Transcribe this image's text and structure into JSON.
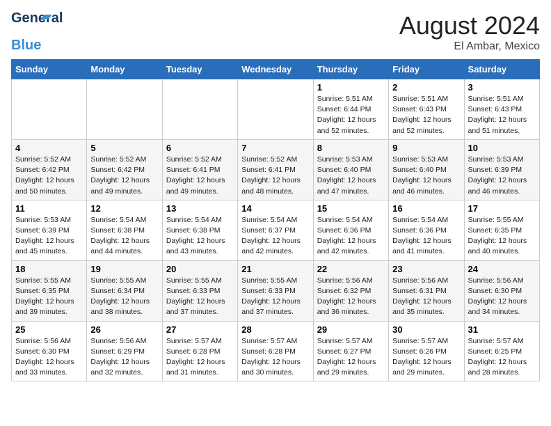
{
  "logo": {
    "line1": "General",
    "line2": "Blue"
  },
  "title": {
    "month": "August 2024",
    "location": "El Ambar, Mexico"
  },
  "header": {
    "days": [
      "Sunday",
      "Monday",
      "Tuesday",
      "Wednesday",
      "Thursday",
      "Friday",
      "Saturday"
    ]
  },
  "weeks": [
    [
      {
        "num": "",
        "info": ""
      },
      {
        "num": "",
        "info": ""
      },
      {
        "num": "",
        "info": ""
      },
      {
        "num": "",
        "info": ""
      },
      {
        "num": "1",
        "info": "Sunrise: 5:51 AM\nSunset: 6:44 PM\nDaylight: 12 hours\nand 52 minutes."
      },
      {
        "num": "2",
        "info": "Sunrise: 5:51 AM\nSunset: 6:43 PM\nDaylight: 12 hours\nand 52 minutes."
      },
      {
        "num": "3",
        "info": "Sunrise: 5:51 AM\nSunset: 6:43 PM\nDaylight: 12 hours\nand 51 minutes."
      }
    ],
    [
      {
        "num": "4",
        "info": "Sunrise: 5:52 AM\nSunset: 6:42 PM\nDaylight: 12 hours\nand 50 minutes."
      },
      {
        "num": "5",
        "info": "Sunrise: 5:52 AM\nSunset: 6:42 PM\nDaylight: 12 hours\nand 49 minutes."
      },
      {
        "num": "6",
        "info": "Sunrise: 5:52 AM\nSunset: 6:41 PM\nDaylight: 12 hours\nand 49 minutes."
      },
      {
        "num": "7",
        "info": "Sunrise: 5:52 AM\nSunset: 6:41 PM\nDaylight: 12 hours\nand 48 minutes."
      },
      {
        "num": "8",
        "info": "Sunrise: 5:53 AM\nSunset: 6:40 PM\nDaylight: 12 hours\nand 47 minutes."
      },
      {
        "num": "9",
        "info": "Sunrise: 5:53 AM\nSunset: 6:40 PM\nDaylight: 12 hours\nand 46 minutes."
      },
      {
        "num": "10",
        "info": "Sunrise: 5:53 AM\nSunset: 6:39 PM\nDaylight: 12 hours\nand 46 minutes."
      }
    ],
    [
      {
        "num": "11",
        "info": "Sunrise: 5:53 AM\nSunset: 6:39 PM\nDaylight: 12 hours\nand 45 minutes."
      },
      {
        "num": "12",
        "info": "Sunrise: 5:54 AM\nSunset: 6:38 PM\nDaylight: 12 hours\nand 44 minutes."
      },
      {
        "num": "13",
        "info": "Sunrise: 5:54 AM\nSunset: 6:38 PM\nDaylight: 12 hours\nand 43 minutes."
      },
      {
        "num": "14",
        "info": "Sunrise: 5:54 AM\nSunset: 6:37 PM\nDaylight: 12 hours\nand 42 minutes."
      },
      {
        "num": "15",
        "info": "Sunrise: 5:54 AM\nSunset: 6:36 PM\nDaylight: 12 hours\nand 42 minutes."
      },
      {
        "num": "16",
        "info": "Sunrise: 5:54 AM\nSunset: 6:36 PM\nDaylight: 12 hours\nand 41 minutes."
      },
      {
        "num": "17",
        "info": "Sunrise: 5:55 AM\nSunset: 6:35 PM\nDaylight: 12 hours\nand 40 minutes."
      }
    ],
    [
      {
        "num": "18",
        "info": "Sunrise: 5:55 AM\nSunset: 6:35 PM\nDaylight: 12 hours\nand 39 minutes."
      },
      {
        "num": "19",
        "info": "Sunrise: 5:55 AM\nSunset: 6:34 PM\nDaylight: 12 hours\nand 38 minutes."
      },
      {
        "num": "20",
        "info": "Sunrise: 5:55 AM\nSunset: 6:33 PM\nDaylight: 12 hours\nand 37 minutes."
      },
      {
        "num": "21",
        "info": "Sunrise: 5:55 AM\nSunset: 6:33 PM\nDaylight: 12 hours\nand 37 minutes."
      },
      {
        "num": "22",
        "info": "Sunrise: 5:56 AM\nSunset: 6:32 PM\nDaylight: 12 hours\nand 36 minutes."
      },
      {
        "num": "23",
        "info": "Sunrise: 5:56 AM\nSunset: 6:31 PM\nDaylight: 12 hours\nand 35 minutes."
      },
      {
        "num": "24",
        "info": "Sunrise: 5:56 AM\nSunset: 6:30 PM\nDaylight: 12 hours\nand 34 minutes."
      }
    ],
    [
      {
        "num": "25",
        "info": "Sunrise: 5:56 AM\nSunset: 6:30 PM\nDaylight: 12 hours\nand 33 minutes."
      },
      {
        "num": "26",
        "info": "Sunrise: 5:56 AM\nSunset: 6:29 PM\nDaylight: 12 hours\nand 32 minutes."
      },
      {
        "num": "27",
        "info": "Sunrise: 5:57 AM\nSunset: 6:28 PM\nDaylight: 12 hours\nand 31 minutes."
      },
      {
        "num": "28",
        "info": "Sunrise: 5:57 AM\nSunset: 6:28 PM\nDaylight: 12 hours\nand 30 minutes."
      },
      {
        "num": "29",
        "info": "Sunrise: 5:57 AM\nSunset: 6:27 PM\nDaylight: 12 hours\nand 29 minutes."
      },
      {
        "num": "30",
        "info": "Sunrise: 5:57 AM\nSunset: 6:26 PM\nDaylight: 12 hours\nand 29 minutes."
      },
      {
        "num": "31",
        "info": "Sunrise: 5:57 AM\nSunset: 6:25 PM\nDaylight: 12 hours\nand 28 minutes."
      }
    ]
  ]
}
